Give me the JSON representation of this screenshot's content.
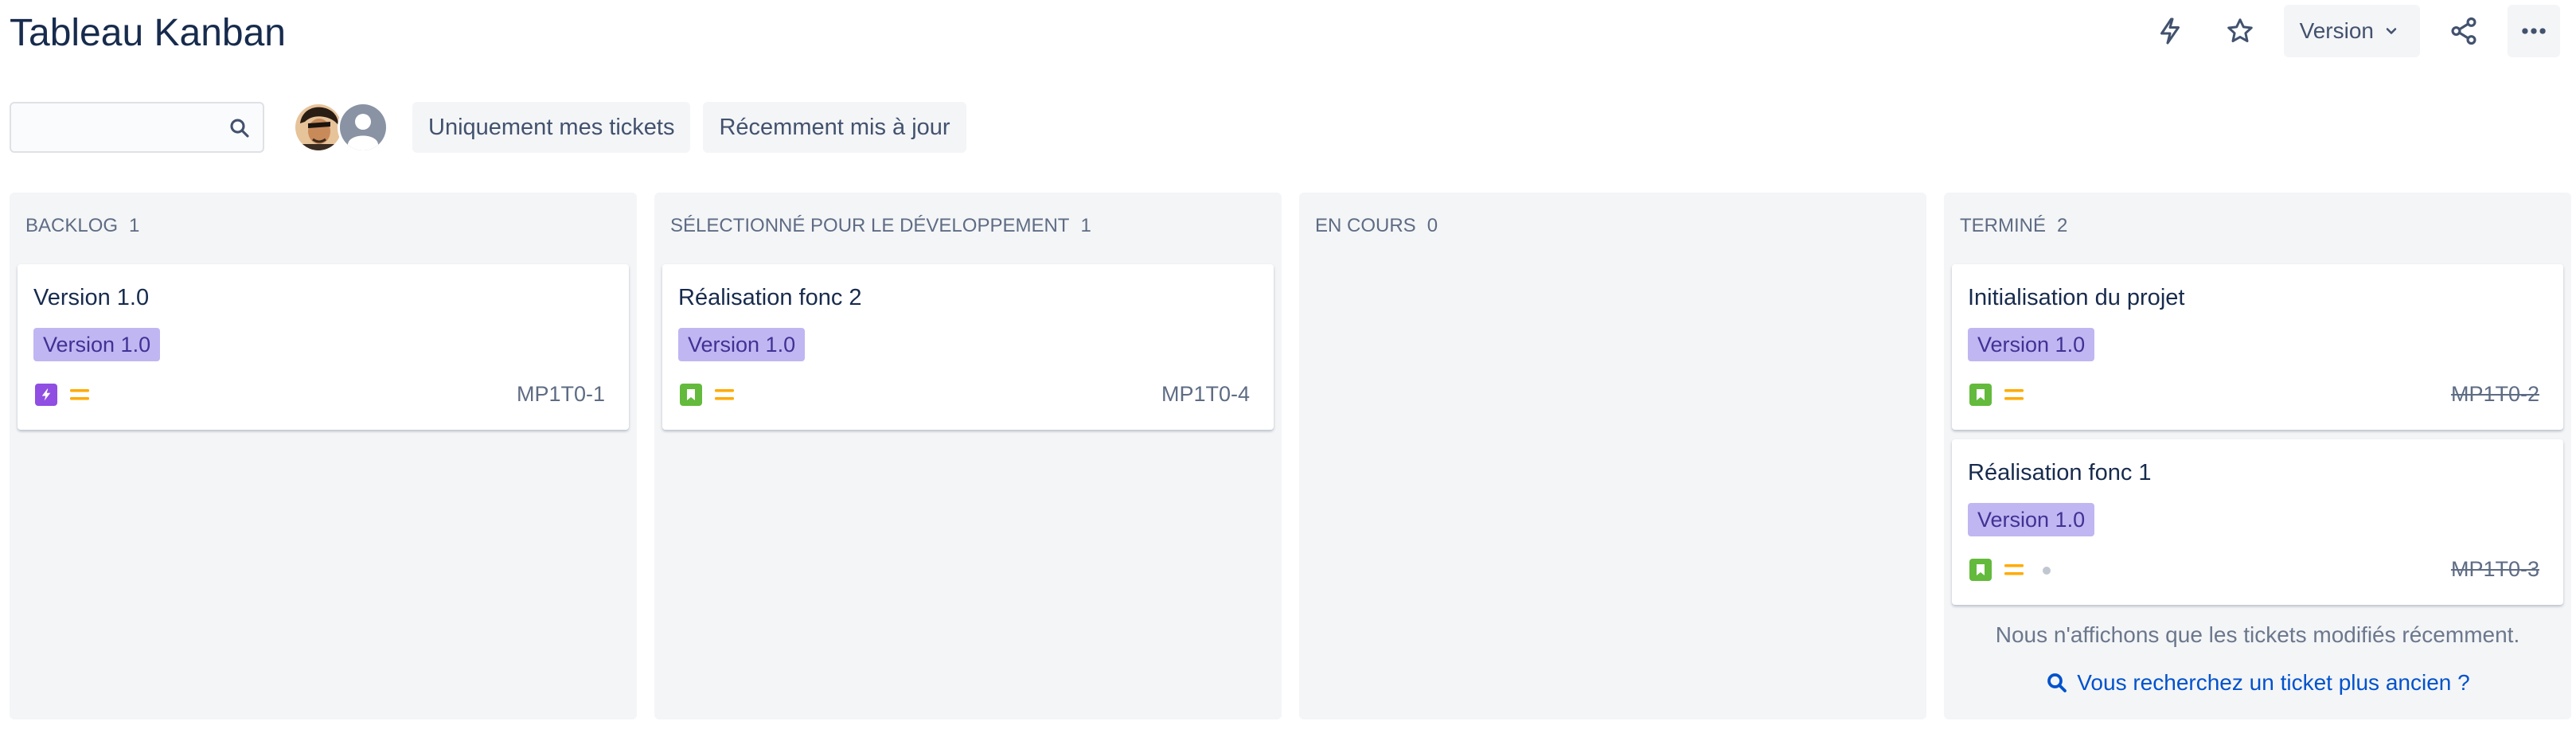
{
  "page": {
    "title": "Tableau Kanban"
  },
  "header_actions": {
    "automation_icon": "lightning-icon",
    "star_icon": "star-icon",
    "version_label": "Version",
    "share_icon": "share-icon",
    "more_icon": "more-icon"
  },
  "toolbar": {
    "search_value": "",
    "filters": [
      "Uniquement mes tickets",
      "Récemment mis à jour"
    ]
  },
  "colors": {
    "epic_bg": "#c0b6f2",
    "epic_text": "#403294",
    "story": "#63ba3c",
    "task": "#904ee2",
    "priority_medium": "#ffab00",
    "link": "#0052cc"
  },
  "columns": [
    {
      "name": "BACKLOG",
      "count": "1",
      "cards": [
        {
          "title": "Version 1.0",
          "epic": "Version 1.0",
          "type": "task",
          "priority": "medium",
          "key": "MP1T0-1"
        }
      ]
    },
    {
      "name": "SÉLECTIONNÉ POUR LE DÉVELOPPEMENT",
      "count": "1",
      "cards": [
        {
          "title": "Réalisation fonc 2",
          "epic": "Version 1.0",
          "type": "story",
          "priority": "medium",
          "key": "MP1T0-4"
        }
      ]
    },
    {
      "name": "EN COURS",
      "count": "0",
      "cards": []
    },
    {
      "name": "TERMINÉ",
      "count": "2",
      "cards": [
        {
          "title": "Initialisation du projet",
          "epic": "Version 1.0",
          "type": "story",
          "priority": "medium",
          "key": "MP1T0-2"
        },
        {
          "title": "Réalisation fonc 1",
          "epic": "Version 1.0",
          "type": "story",
          "priority": "medium",
          "key": "MP1T0-3"
        }
      ],
      "notice": "Nous n'affichons que les tickets modifiés récemment.",
      "older_link": "Vous recherchez un ticket plus ancien ?"
    }
  ]
}
